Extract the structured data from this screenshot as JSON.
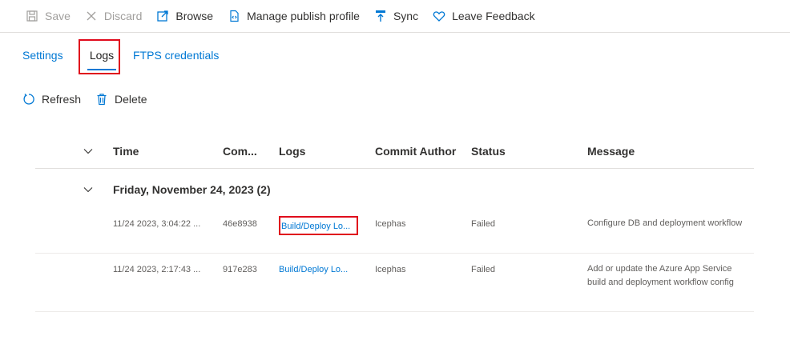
{
  "toolbar": {
    "save_label": "Save",
    "discard_label": "Discard",
    "browse_label": "Browse",
    "manage_label": "Manage publish profile",
    "sync_label": "Sync",
    "feedback_label": "Leave Feedback"
  },
  "tabs": [
    {
      "label": "Settings"
    },
    {
      "label": "Logs"
    },
    {
      "label": "FTPS credentials"
    }
  ],
  "actions": {
    "refresh_label": "Refresh",
    "delete_label": "Delete"
  },
  "table": {
    "columns": [
      "Time",
      "Com...",
      "Logs",
      "Commit Author",
      "Status",
      "Message"
    ],
    "group_title": "Friday, November 24, 2023 (2)",
    "rows": [
      {
        "time": "11/24 2023, 3:04:22 ...",
        "commit": "46e8938",
        "logs": "Build/Deploy Lo...",
        "author": "Icephas",
        "status": "Failed",
        "message": "Configure DB and deployment workflow"
      },
      {
        "time": "11/24 2023, 2:17:43 ...",
        "commit": "917e283",
        "logs": "Build/Deploy Lo...",
        "author": "Icephas",
        "status": "Failed",
        "message": "Add or update the Azure App Service build and deployment workflow config"
      }
    ]
  },
  "colors": {
    "accent": "#0078d4",
    "highlight": "#e00b1c"
  }
}
